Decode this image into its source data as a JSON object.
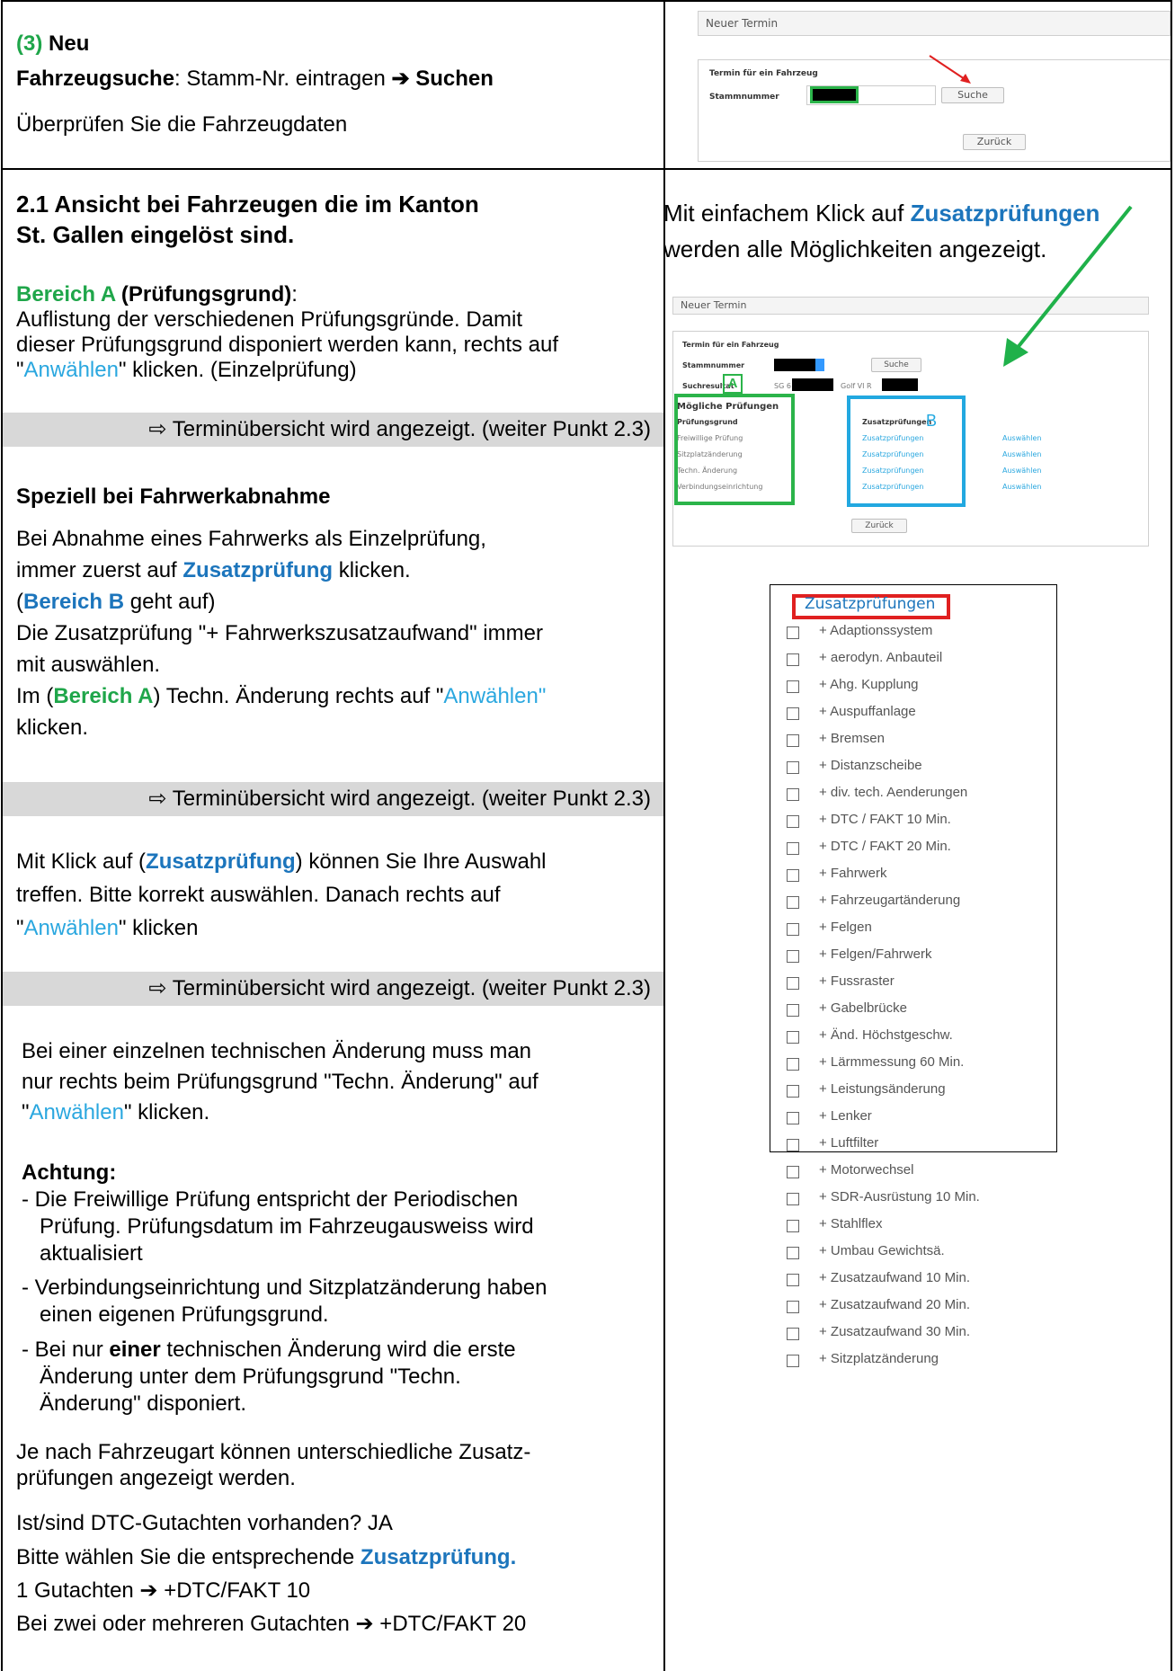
{
  "top_left": {
    "step": "(3)",
    "step_title": "Neu",
    "line2_bold": "Fahrzeugsuche",
    "line2_rest": ": Stamm-Nr. eintragen ",
    "line2_arrow": "➔",
    "line2_end": "Suchen",
    "line3": "Überprüfen Sie die Fahrzeugdaten"
  },
  "top_shot": {
    "header": "Neuer Termin",
    "panel_title": "Termin für ein Fahrzeug",
    "label": "Stammnummer",
    "search_button": "Suche",
    "back_button": "Zurück"
  },
  "section": {
    "heading1": "2.1 Ansicht bei Fahrzeugen die im Kanton",
    "heading2": "St. Gallen eingelöst sind.",
    "areaA_label": "Bereich A",
    "areaA_rest": " (Prüfungsgrund)",
    "areaA_colon": ":",
    "p1": "Auflistung der verschiedenen Prüfungsgründe. Damit",
    "p2": "dieser Prüfungsgrund disponiert werden kann, rechts auf",
    "p3_q1": "\"",
    "p3_link": "Anwählen",
    "p3_rest": "\" klicken. (Einzelprüfung)",
    "bar_text": "⇨ Terminübersicht wird angezeigt. (weiter Punkt 2.3)",
    "special_heading": "Speziell bei Fahrwerkabnahme",
    "s1": "Bei Abnahme eines Fahrwerks als Einzelprüfung,",
    "s2_pre": "immer zuerst auf ",
    "s2_link": "Zusatzprüfung",
    "s2_post": " klicken.",
    "s3_pre": "(",
    "s3_link": "Bereich B",
    "s3_post": " geht auf)",
    "s4": "Die Zusatzprüfung \"+ Fahrwerkszusatzaufwand\" immer",
    "s5": "mit auswählen.",
    "s6_pre": "Im (",
    "s6_area": "Bereich A",
    "s6_mid": ") Techn. Änderung rechts auf \"",
    "s6_link": "Anwählen\"",
    "s7": "klicken.",
    "m1_pre": "Mit Klick auf (",
    "m1_link": "Zusatzprüfung",
    "m1_post": ") können Sie Ihre Auswahl",
    "m2": "treffen. Bitte korrekt auswählen. Danach rechts auf",
    "m3_q": "\"",
    "m3_link": "Anwählen",
    "m3_post": "\" klicken",
    "e1": "Bei einer einzelnen technischen Änderung muss man",
    "e2": "nur rechts beim Prüfungsgrund \"Techn. Änderung\" auf",
    "e3_q": "\"",
    "e3_link": "Anwählen",
    "e3_post": "\" klicken.",
    "attention": "Achtung:",
    "a1": "- Die Freiwillige Prüfung entspricht der Periodischen",
    "a2": "Prüfung. Prüfungsdatum im Fahrzeugausweiss wird",
    "a3": "aktualisiert",
    "a4": "- Verbindungseinrichtung und Sitzplatzänderung haben",
    "a5": "einen eigenen Prüfungsgrund.",
    "a6_pre": "- Bei nur ",
    "a6_bold": "einer",
    "a6_post": " technischen Änderung wird die erste",
    "a7": "Änderung unter dem Prüfungsgrund \"Techn.",
    "a8": "Änderung\" disponiert.",
    "f1": "Je nach Fahrzeugart können unterschiedliche Zusatz-",
    "f2": "prüfungen angezeigt werden.",
    "f3": "Ist/sind DTC-Gutachten vorhanden? JA",
    "f4_pre": "Bitte wählen Sie die entsprechende ",
    "f4_link": "Zusatzprüfung.",
    "f5": "1 Gutachten ➔ +DTC/FAKT 10",
    "f6": "Bei zwei oder mehreren Gutachten ➔ +DTC/FAKT 20"
  },
  "right": {
    "intro1_pre": "Mit einfachem Klick auf ",
    "intro1_link": "Zusatzprüfungen",
    "intro2": "werden alle Möglichkeiten angezeigt.",
    "shot2": {
      "header": "Neuer Termin",
      "panel_title": "Termin für ein Fahrzeug",
      "label1": "Stammnummer",
      "label2": "Suchresultat",
      "result_prefix": "SG 6",
      "result_model": "Golf VI R",
      "search_button": "Suche",
      "section_title": "Mögliche Prüfungen",
      "col1_header": "Prüfungsgrund",
      "col2_header": "Zusatzprüfungen",
      "rows": [
        {
          "reason": "Freiwillige Prüfung",
          "extra": "Zusatzprüfungen",
          "action": "Auswählen"
        },
        {
          "reason": "Sitzplatzänderung",
          "extra": "Zusatzprüfungen",
          "action": "Auswählen"
        },
        {
          "reason": "Techn. Änderung",
          "extra": "Zusatzprüfungen",
          "action": "Auswählen"
        },
        {
          "reason": "Verbindungseinrichtung",
          "extra": "Zusatzprüfungen",
          "action": "Auswählen"
        }
      ],
      "marker_a": "A",
      "marker_b": "B",
      "back_button": "Zurück"
    },
    "list_title": "Zusatzprüfungen",
    "list": [
      "+ Adaptionssystem",
      "+ aerodyn. Anbauteil",
      "+ Ahg. Kupplung",
      "+ Auspuffanlage",
      "+ Bremsen",
      "+ Distanzscheibe",
      "+ div. tech. Aenderungen",
      "+ DTC / FAKT 10 Min.",
      "+ DTC / FAKT 20 Min.",
      "+ Fahrwerk",
      "+ Fahrzeugartänderung",
      "+ Felgen",
      "+ Felgen/Fahrwerk",
      "+ Fussraster",
      "+ Gabelbrücke",
      "+ Änd. Höchstgeschw.",
      "+ Lärmmessung 60 Min.",
      "+ Leistungsänderung",
      "+ Lenker",
      "+ Luftfilter",
      "+ Motorwechsel",
      "+ SDR-Ausrüstung 10 Min.",
      "+ Stahlflex",
      "+ Umbau Gewichtsä.",
      "+ Zusatzaufwand 10 Min.",
      "+ Zusatzaufwand 20 Min.",
      "+ Zusatzaufwand 30 Min.",
      "+ Sitzplatzänderung"
    ]
  },
  "colors": {
    "green": "#1fa64a",
    "blue": "#1c75bc",
    "link": "#2aa7df",
    "red": "#e02020",
    "cyan_box": "#22a8e0"
  }
}
